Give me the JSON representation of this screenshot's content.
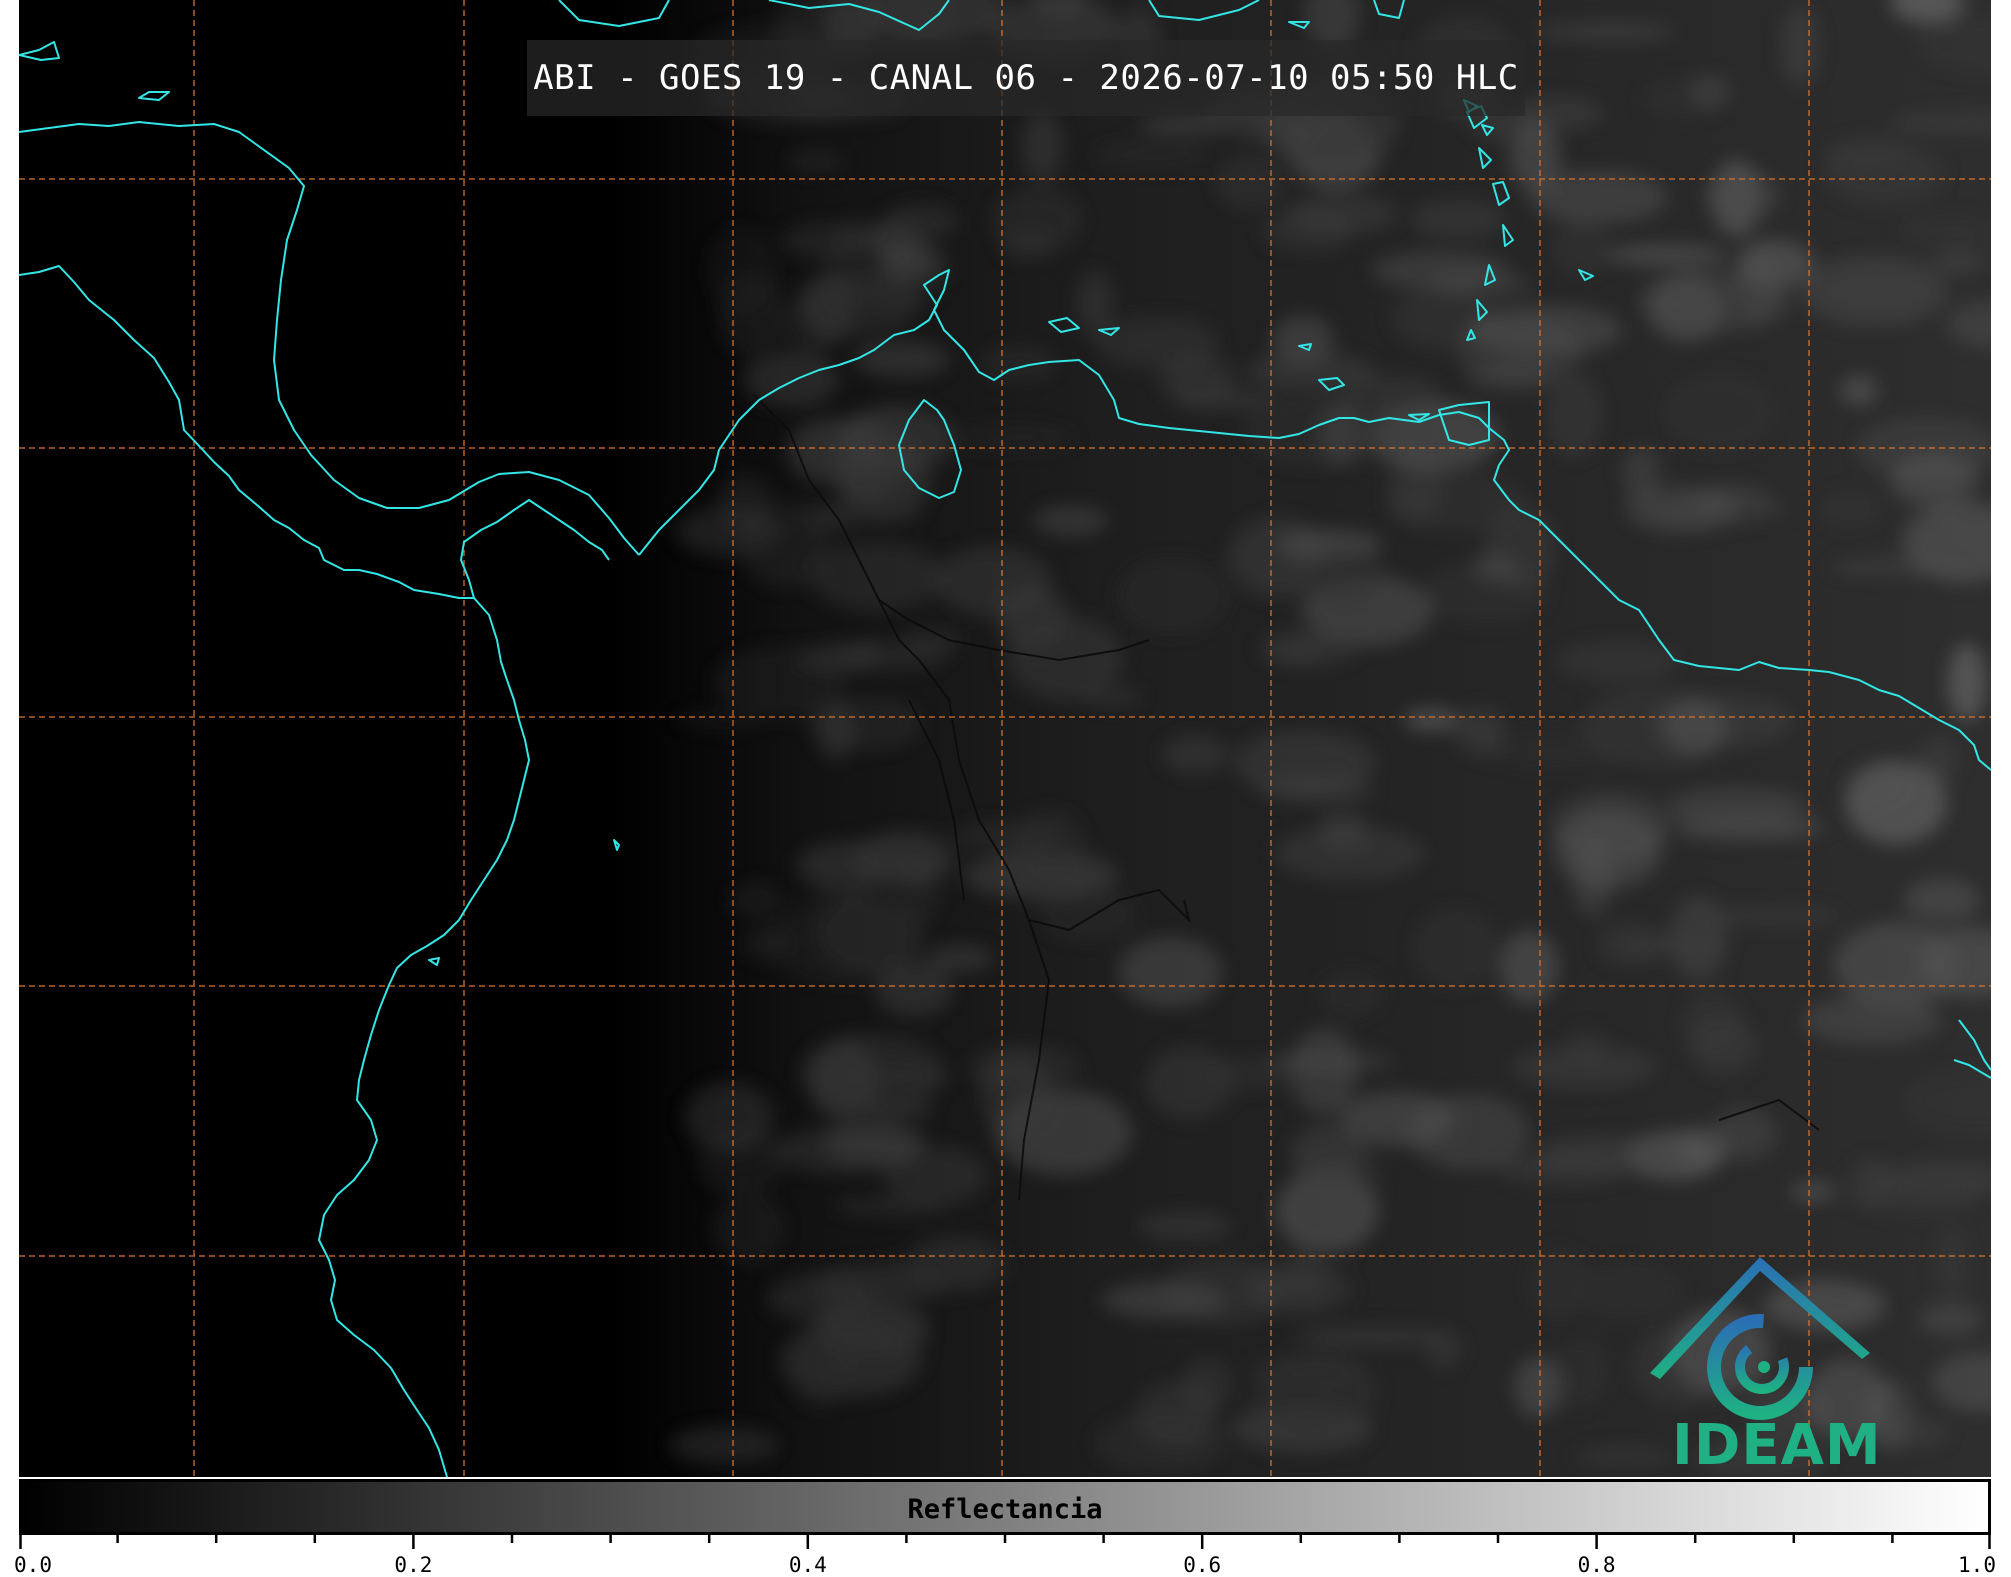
{
  "title": "ABI - GOES 19 - CANAL 06 - 2026-07-10 05:50 HLC",
  "logo": {
    "text": "IDEAM",
    "icon": "ideam-swirl-roof-icon",
    "color_top": "#2a6fb5",
    "color_bottom": "#1fb083"
  },
  "colorbar": {
    "label": "Reflectancia",
    "min": 0.0,
    "max": 1.0,
    "major_ticks": [
      "0.0",
      "0.2",
      "0.4",
      "0.6",
      "0.8",
      "1.0"
    ],
    "minor_tick_step": 0.05,
    "color_low": "#000000",
    "color_high": "#ffffff"
  },
  "map": {
    "coastline_color": "#33e6e6",
    "gridline_color": "#d9732a",
    "border_color": "#111111",
    "background_color": "#000000",
    "cloud_color": "#8a8a8a"
  }
}
